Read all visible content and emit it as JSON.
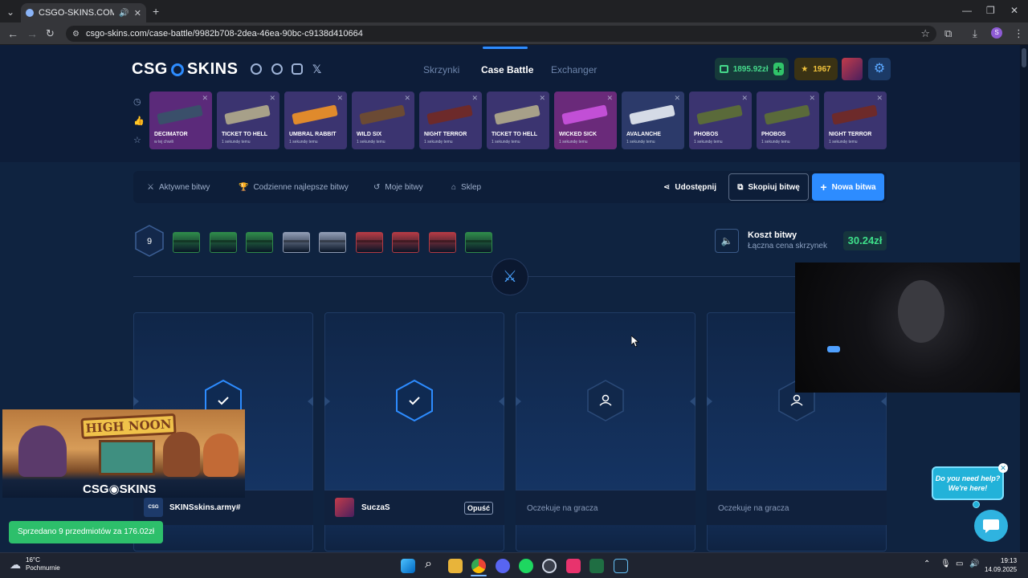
{
  "browser": {
    "tab_title": "CSGO-SKINS.COM - Najlep",
    "url": "csgo-skins.com/case-battle/9982b708-2dea-46ea-90bc-c9138d410664",
    "profile_initial": "S"
  },
  "site": {
    "logo_left": "CSG",
    "logo_right": "SKINS",
    "nav": [
      {
        "label": "Skrzynki"
      },
      {
        "label": "Case Battle"
      },
      {
        "label": "Exchanger"
      }
    ],
    "balance": "1895.92zł",
    "points": "1967"
  },
  "drops": [
    {
      "name": "DECIMATOR",
      "sub": "w tej chwili",
      "bg": "#5b2a7a",
      "gun": "#3a4f6a"
    },
    {
      "name": "TICKET TO HELL",
      "sub": "1 sekundę temu",
      "bg": "#3b3470",
      "gun": "#a7a089"
    },
    {
      "name": "UMBRAL RABBIT",
      "sub": "1 sekundę temu",
      "bg": "#3b3470",
      "gun": "#e08a2c"
    },
    {
      "name": "WILD SIX",
      "sub": "1 sekundę temu",
      "bg": "#3b3470",
      "gun": "#6b4a34"
    },
    {
      "name": "NIGHT TERROR",
      "sub": "1 sekundę temu",
      "bg": "#3b3470",
      "gun": "#6d2a2a"
    },
    {
      "name": "TICKET TO HELL",
      "sub": "1 sekundę temu",
      "bg": "#3b3470",
      "gun": "#a7a089"
    },
    {
      "name": "WICKED SICK",
      "sub": "1 sekundę temu",
      "bg": "#6a2a7a",
      "gun": "#c24fd6"
    },
    {
      "name": "AVALANCHE",
      "sub": "1 sekundę temu",
      "bg": "#2c3a6a",
      "gun": "#d5dbe6"
    },
    {
      "name": "PHOBOS",
      "sub": "1 sekundę temu",
      "bg": "#3b3470",
      "gun": "#5a6a3a"
    },
    {
      "name": "PHOBOS",
      "sub": "1 sekundę temu",
      "bg": "#3b3470",
      "gun": "#5a6a3a"
    },
    {
      "name": "NIGHT TERROR",
      "sub": "1 sekundę temu",
      "bg": "#3b3470",
      "gun": "#6d2a2a"
    }
  ],
  "battle_tabs": [
    {
      "label": "Aktywne bitwy"
    },
    {
      "label": "Codzienne najlepsze bitwy"
    },
    {
      "label": "Moje bitwy"
    },
    {
      "label": "Sklep"
    }
  ],
  "actions": {
    "share": "Udostępnij",
    "copy": "Skopiuj bitwę",
    "new": "Nowa bitwa"
  },
  "rounds": "9",
  "cases": [
    "#2f8a4a",
    "#2f8a4a",
    "#2f8a4a",
    "#8f9bb3",
    "#8f9bb3",
    "#b23b45",
    "#b23b45",
    "#b23b45",
    "#2f8a4a"
  ],
  "cost": {
    "title": "Koszt bitwy",
    "subtitle": "Łączna cena skrzynek",
    "value": "30.24zł"
  },
  "players": [
    {
      "name": "SKINSskins.army#",
      "status": "ready"
    },
    {
      "name": "SuczaS",
      "status": "ready",
      "action": "Opuść"
    },
    {
      "name": "Oczekuje na gracza",
      "status": "waiting"
    },
    {
      "name": "Oczekuje na gracza",
      "status": "waiting"
    }
  ],
  "banner": {
    "sign": "HIGH NOON",
    "logo": "CSG◉SKINS"
  },
  "help": {
    "line1": "Do you need help?",
    "line2": "We're here!"
  },
  "toast": "Sprzedano 9 przedmiotów za 176.02zł",
  "taskbar": {
    "temp": "16°C",
    "weather": "Pochmurnie",
    "time": "19:13",
    "date": "14.09.2025"
  },
  "colors": {
    "accent": "#2d8cff",
    "success": "#3ee08a",
    "gold": "#f2c43d",
    "page_bg": "#0f2340"
  }
}
